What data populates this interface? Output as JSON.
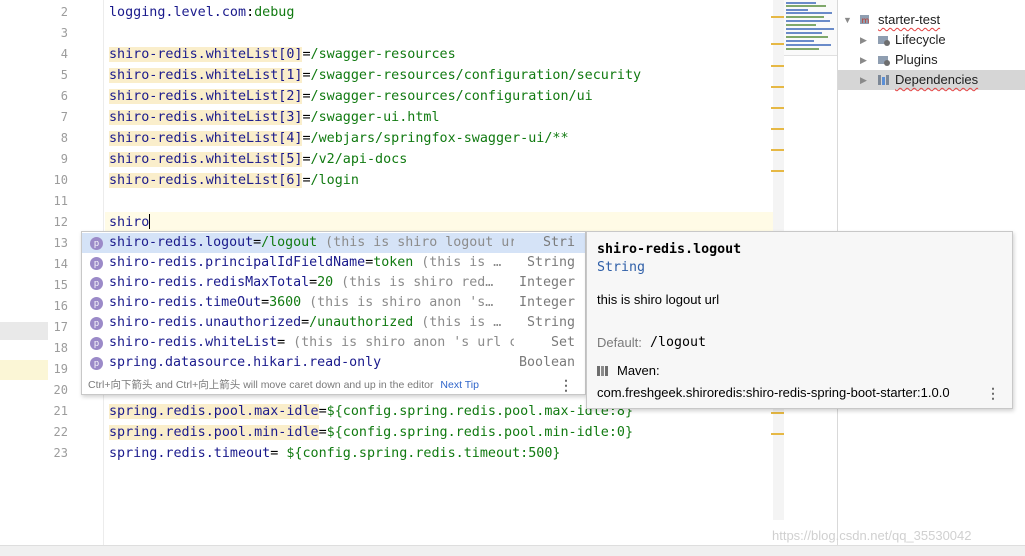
{
  "editor": {
    "line_numbers": [
      "2",
      "3",
      "4",
      "5",
      "6",
      "7",
      "8",
      "9",
      "10",
      "11",
      "12",
      "13",
      "14",
      "15",
      "16",
      "17",
      "18",
      "19",
      "20",
      "21",
      "22",
      "23"
    ],
    "lines": [
      {
        "key": "logging.level.com",
        "op": ":",
        "val": "debug",
        "hl": false
      },
      {
        "key": "",
        "op": "",
        "val": "",
        "hl": false
      },
      {
        "key": "shiro-redis.whiteList[0]",
        "op": "=",
        "val": "/swagger-resources",
        "hl": true
      },
      {
        "key": "shiro-redis.whiteList[1]",
        "op": "=",
        "val": "/swagger-resources/configuration/security",
        "hl": true
      },
      {
        "key": "shiro-redis.whiteList[2]",
        "op": "=",
        "val": "/swagger-resources/configuration/ui",
        "hl": true
      },
      {
        "key": "shiro-redis.whiteList[3]",
        "op": "=",
        "val": "/swagger-ui.html",
        "hl": true
      },
      {
        "key": "shiro-redis.whiteList[4]",
        "op": "=",
        "val": "/webjars/springfox-swagger-ui/**",
        "hl": true
      },
      {
        "key": "shiro-redis.whiteList[5]",
        "op": "=",
        "val": "/v2/api-docs",
        "hl": true
      },
      {
        "key": "shiro-redis.whiteList[6]",
        "op": "=",
        "val": "/login",
        "hl": true
      },
      {
        "key": "",
        "op": "",
        "val": "",
        "hl": false
      },
      {
        "key": "shiro",
        "op": "",
        "val": "",
        "hl": false
      },
      {
        "key": "",
        "op": "",
        "val": "",
        "hl": false
      },
      {
        "key": "",
        "op": "",
        "val": "",
        "hl": false
      },
      {
        "key": "",
        "op": "",
        "val": "",
        "hl": false
      },
      {
        "key": "",
        "op": "",
        "val": "",
        "hl": false
      },
      {
        "key": "",
        "op": "",
        "val": "",
        "hl": false
      },
      {
        "key": "",
        "op": "",
        "val": "",
        "hl": false
      },
      {
        "key": "",
        "op": "",
        "val": "",
        "hl": false
      },
      {
        "key": "",
        "op": "",
        "val": "",
        "hl": false
      },
      {
        "key": "spring.redis.pool.max-idle",
        "op": "=",
        "val": "${config.spring.redis.pool.max-idle:8}",
        "hl": true
      },
      {
        "key": "spring.redis.pool.min-idle",
        "op": "=",
        "val": "${config.spring.redis.pool.min-idle:0}",
        "hl": true
      },
      {
        "key": "spring.redis.timeout",
        "op": "= ",
        "val": "${config.spring.redis.timeout:500}",
        "hl": false
      }
    ],
    "current_line_index": 10
  },
  "completion": {
    "items": [
      {
        "name": "shiro-redis.logout",
        "eq": "=",
        "val": "/logout",
        "tail": " (this is shiro logout url)",
        "type": "Stri",
        "selected": true
      },
      {
        "name": "shiro-redis.principalIdFieldName",
        "eq": "=",
        "val": "token",
        "tail": " (this is …",
        "type": "String",
        "selected": false
      },
      {
        "name": "shiro-redis.redisMaxTotal",
        "eq": "=",
        "val": "20",
        "tail": " (this is shiro red…",
        "type": "Integer",
        "selected": false
      },
      {
        "name": "shiro-redis.timeOut",
        "eq": "=",
        "val": "3600",
        "tail": " (this is shiro anon 's…",
        "type": "Integer",
        "selected": false
      },
      {
        "name": "shiro-redis.unauthorized",
        "eq": "=",
        "val": "/unauthorized",
        "tail": " (this is …",
        "type": "String",
        "selected": false
      },
      {
        "name": "shiro-redis.whiteList",
        "eq": "= ",
        "val": "",
        "tail": "(this is shiro anon 's url c…",
        "type": "Set",
        "selected": false
      },
      {
        "name": "spring.datasource.hikari.read-only",
        "eq": "",
        "val": "",
        "tail": "",
        "type": "Boolean",
        "selected": false
      }
    ],
    "item_icon_letter": "p",
    "footer_hint": "Ctrl+向下箭头 and Ctrl+向上箭头 will move caret down and up in the editor",
    "next_tip": "Next Tip",
    "more_glyph": "⋮"
  },
  "documentation": {
    "title": "shiro-redis.logout",
    "type": "String",
    "description": "this is shiro logout url",
    "default_label": "Default:",
    "default_value": "/logout",
    "maven_label": "Maven:",
    "maven_coord": "com.freshgeek.shiroredis:shiro-redis-spring-boot-starter:1.0.0",
    "more_glyph": "⋮"
  },
  "project_tree": {
    "root": "starter-test",
    "items": [
      {
        "label": "Lifecycle",
        "selected": false
      },
      {
        "label": "Plugins",
        "selected": false
      },
      {
        "label": "Dependencies",
        "selected": true
      }
    ]
  },
  "watermark": "https://blog.csdn.net/qq_35530042",
  "colors": {
    "key": "#1a1a8c",
    "value": "#117a11",
    "key_highlight": "#faeecb",
    "selection": "#d5e3f7",
    "warning_marker": "#e6b844"
  }
}
